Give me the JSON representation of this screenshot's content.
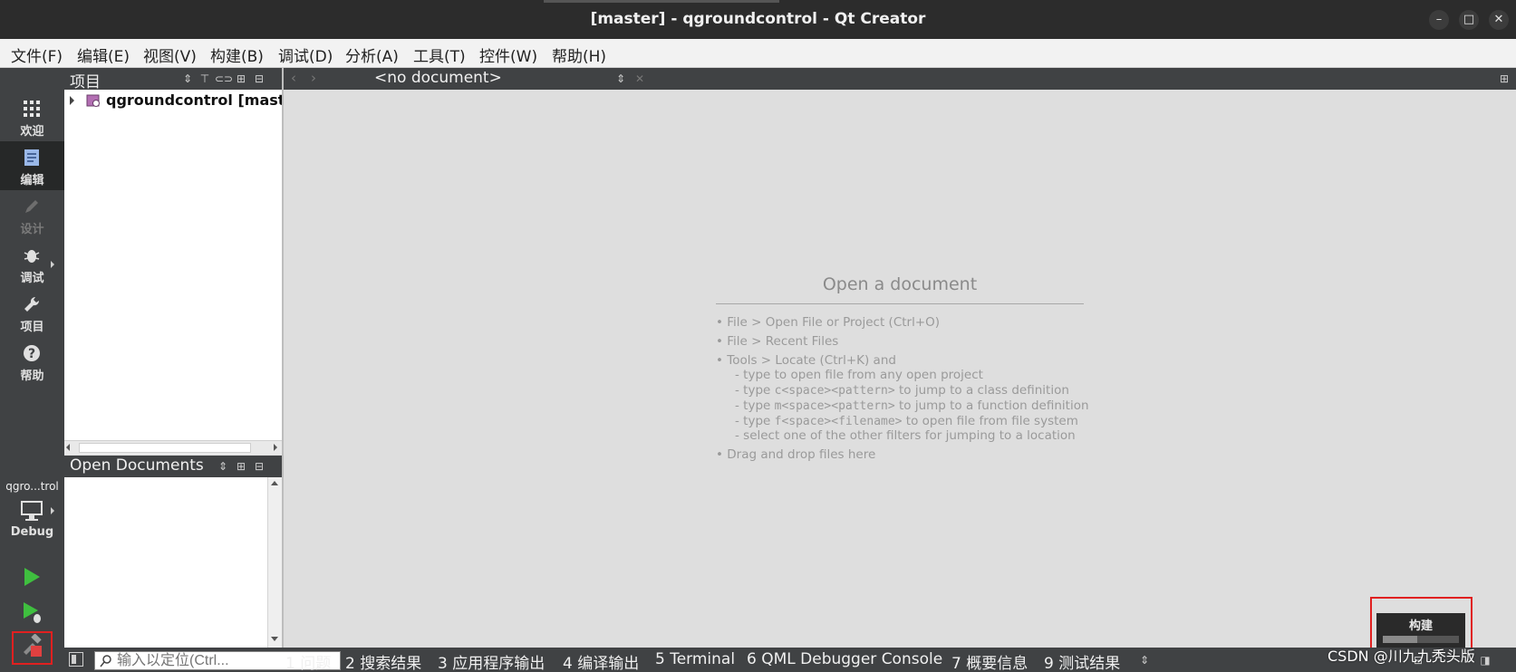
{
  "window": {
    "title": "[master] - qgroundcontrol - Qt Creator",
    "controls": [
      "–",
      "□",
      "✕"
    ]
  },
  "menubar": {
    "items": [
      "文件(F)",
      "编辑(E)",
      "视图(V)",
      "构建(B)",
      "调试(D)",
      "分析(A)",
      "工具(T)",
      "控件(W)",
      "帮助(H)"
    ]
  },
  "modebar": {
    "modes": [
      {
        "label": "欢迎",
        "icon": "grid-icon"
      },
      {
        "label": "编辑",
        "icon": "document-icon",
        "active": true
      },
      {
        "label": "设计",
        "icon": "pencil-icon",
        "disabled": true
      },
      {
        "label": "调试",
        "icon": "bug-icon"
      },
      {
        "label": "项目",
        "icon": "wrench-icon"
      },
      {
        "label": "帮助",
        "icon": "question-icon"
      }
    ],
    "kit_project": "qgro...trol",
    "kit_build": "Debug"
  },
  "projects": {
    "title": "项目",
    "root_item": "qgroundcontrol [master]"
  },
  "open_documents": {
    "title": "Open Documents"
  },
  "editor": {
    "document_combo": "<no document>",
    "hint_title": "Open a document",
    "hints": {
      "open_file": "• File > Open File or Project (Ctrl+O)",
      "recent": "• File > Recent Files",
      "locate": "• Tools > Locate (Ctrl+K) and",
      "type_open": "- type to open file from any open project",
      "c_prefix": "- type ",
      "c_code": "c<space><pattern>",
      "c_suffix": " to jump to a class definition",
      "m_prefix": "- type ",
      "m_code": "m<space><pattern>",
      "m_suffix": " to jump to a function definition",
      "f_prefix": "- type ",
      "f_code": "f<space><filename>",
      "f_suffix": " to open file from file system",
      "select_other": "- select one of the other filters for jumping to a location",
      "drag": "• Drag and drop files here"
    }
  },
  "statusbar": {
    "locator_placeholder": "输入以定位(Ctrl...",
    "tabs": [
      "1 问题",
      "2 搜索结果",
      "3 应用程序输出",
      "4 编译输出",
      "5 Terminal",
      "6 QML Debugger Console",
      "7 概要信息",
      "9 测试结果"
    ]
  },
  "build_progress": {
    "label": "构建",
    "progress": 0.45
  },
  "watermark": "CSDN @川九九秃头版",
  "colors": {
    "highlight_box": "#e02020",
    "run_green": "#3fbf3f",
    "build_red": "#e04040"
  }
}
